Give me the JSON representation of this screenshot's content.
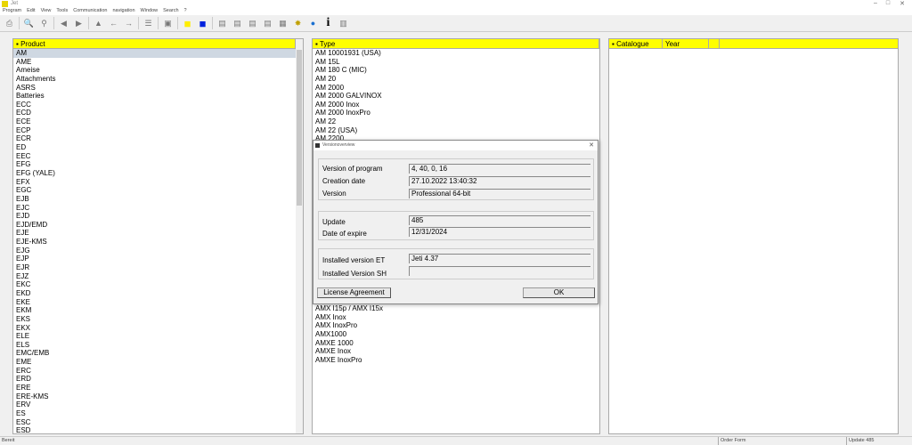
{
  "window": {
    "title": "Jet"
  },
  "menu": [
    "Program",
    "Edit",
    "View",
    "Tools",
    "Communication",
    "navigation",
    "Window",
    "Search",
    "?"
  ],
  "toolbar_icons": [
    "print-icon",
    "zoom-in-icon",
    "search-icon",
    "back-triangle-icon",
    "forward-triangle-icon",
    "up-icon",
    "arrow-left-icon",
    "arrow-right-icon",
    "tree-icon",
    "clipboard-icon",
    "yellow-square-icon",
    "blue-square-icon",
    "ersatzteil-icon",
    "et-icon",
    "abc-icon",
    "123-icon",
    "save-icon",
    "sparkle-icon",
    "globe-icon",
    "info-icon",
    "grid-icon"
  ],
  "product": {
    "header": "Product",
    "items": [
      "AM",
      "AME",
      "Ameise",
      "Attachments",
      "ASRS",
      "Batteries",
      "ECC",
      "ECD",
      "ECE",
      "ECP",
      "ECR",
      "ED",
      "EEC",
      "EFG",
      "EFG (YALE)",
      "EFX",
      "EGC",
      "EJB",
      "EJC",
      "EJD",
      "EJD/EMD",
      "EJE",
      "EJE-KMS",
      "EJG",
      "EJP",
      "EJR",
      "EJZ",
      "EKC",
      "EKD",
      "EKE",
      "EKM",
      "EKS",
      "EKX",
      "ELE",
      "ELS",
      "EMC/EMB",
      "EME",
      "ERC",
      "ERD",
      "ERE",
      "ERE-KMS",
      "ERV",
      "ES",
      "ESC",
      "ESD"
    ]
  },
  "type": {
    "header": "Type",
    "items_top": [
      "AM 10001931 (USA)",
      "AM 15L",
      "AM 180 C (MIC)",
      "AM 20",
      "AM 2000",
      "AM 2000 GALVINOX",
      "AM 2000 Inox",
      "AM 2000 InoxPro",
      "AM 22",
      "AM 22 (USA)",
      "AM 2200"
    ],
    "items_bottom": [
      "AMX I15p / AMX I15x",
      "AMX Inox",
      "AMX InoxPro",
      "AMX1000",
      "AMXE 1000",
      "AMXE Inox",
      "AMXE InoxPro"
    ]
  },
  "catalogue": {
    "headers": [
      "Catalogue",
      "Year"
    ]
  },
  "dialog": {
    "title": "Versionoverview",
    "fields": [
      {
        "label": "Version of program",
        "value": "4, 40, 0, 16"
      },
      {
        "label": "Creation date",
        "value": "27.10.2022 13:40:32"
      },
      {
        "label": "Version",
        "value": "Professional 64-bit"
      },
      {
        "label": "Update",
        "value": "485"
      },
      {
        "label": "Date of expire",
        "value": "12/31/2024"
      },
      {
        "label": "Installed version ET",
        "value": "Jeti 4.37"
      },
      {
        "label": "Installed Version SH",
        "value": ""
      }
    ],
    "license_button": "License Agreement",
    "ok_button": "OK"
  },
  "status": {
    "left": "Bereit",
    "middle": "Order Form",
    "right": "Update 485"
  }
}
